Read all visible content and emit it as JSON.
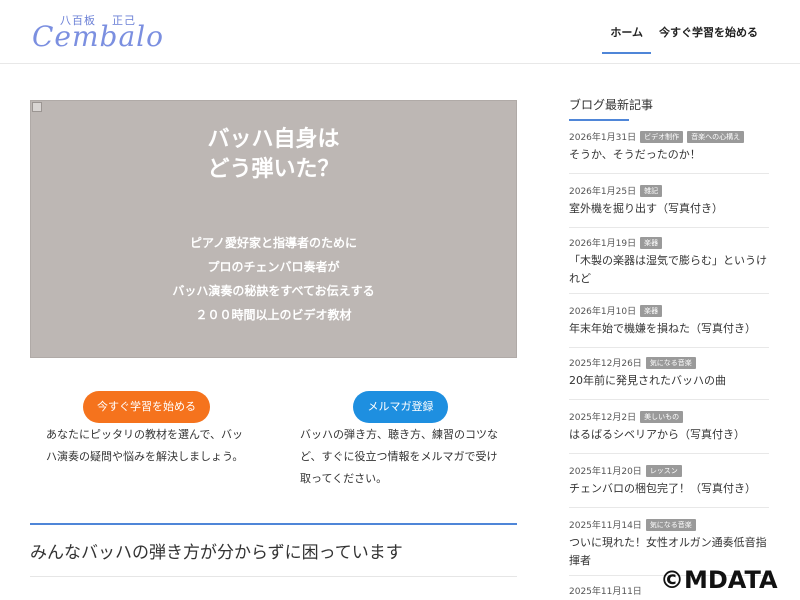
{
  "header": {
    "logo_jp_left": "八百板",
    "logo_jp_right": "正己",
    "logo_script": "Cembalo",
    "nav": [
      {
        "label": "ホーム",
        "active": true
      },
      {
        "label": "今すぐ学習を始める",
        "active": false
      }
    ]
  },
  "hero": {
    "title_line1": "バッハ自身は",
    "title_line2": "どう弾いた？",
    "lines": [
      "ピアノ愛好家と指導者のために",
      "プロのチェンバロ奏者が",
      "バッハ演奏の秘訣をすべてお伝えする",
      "２００時間以上のビデオ教材"
    ],
    "bg_color": "#bdb7b4"
  },
  "cta": {
    "left_button": "今すぐ学習を始める",
    "left_desc": "あなたにピッタリの教材を選んで、バッハ演奏の疑問や悩みを解決しましょう。",
    "right_button": "メルマガ登録",
    "right_desc": "バッハの弾き方、聴き方、練習のコツなど、すぐに役立つ情報をメルマガで受け取ってください。",
    "left_color": "#f5731d",
    "right_color": "#1e8fe0"
  },
  "section": {
    "title": "みんなバッハの弾き方が分からずに困っています"
  },
  "sidebar": {
    "heading": "ブログ最新記事",
    "posts": [
      {
        "date": "2026年1月31日",
        "badges": [
          "ビデオ制作",
          "音楽への心構え"
        ],
        "title": "そうか、そうだったのか！"
      },
      {
        "date": "2026年1月25日",
        "badges": [
          "雑記"
        ],
        "title": "室外機を掘り出す（写真付き）"
      },
      {
        "date": "2026年1月19日",
        "badges": [
          "楽器"
        ],
        "title": "「木製の楽器は湿気で膨らむ」というけれど"
      },
      {
        "date": "2026年1月10日",
        "badges": [
          "楽器"
        ],
        "title": "年末年始で機嫌を損ねた（写真付き）"
      },
      {
        "date": "2025年12月26日",
        "badges": [
          "気になる音楽"
        ],
        "title": "20年前に発見されたバッハの曲"
      },
      {
        "date": "2025年12月2日",
        "badges": [
          "美しいもの"
        ],
        "title": "はるばるシベリアから（写真付き）"
      },
      {
        "date": "2025年11月20日",
        "badges": [
          "レッスン"
        ],
        "title": "チェンバロの梱包完了！（写真付き）"
      },
      {
        "date": "2025年11月14日",
        "badges": [
          "気になる音楽"
        ],
        "title": "ついに現れた！女性オルガン通奏低音指揮者"
      },
      {
        "date": "2025年11月11日",
        "badges": [],
        "title": ""
      }
    ]
  },
  "watermark": "©MDATA"
}
